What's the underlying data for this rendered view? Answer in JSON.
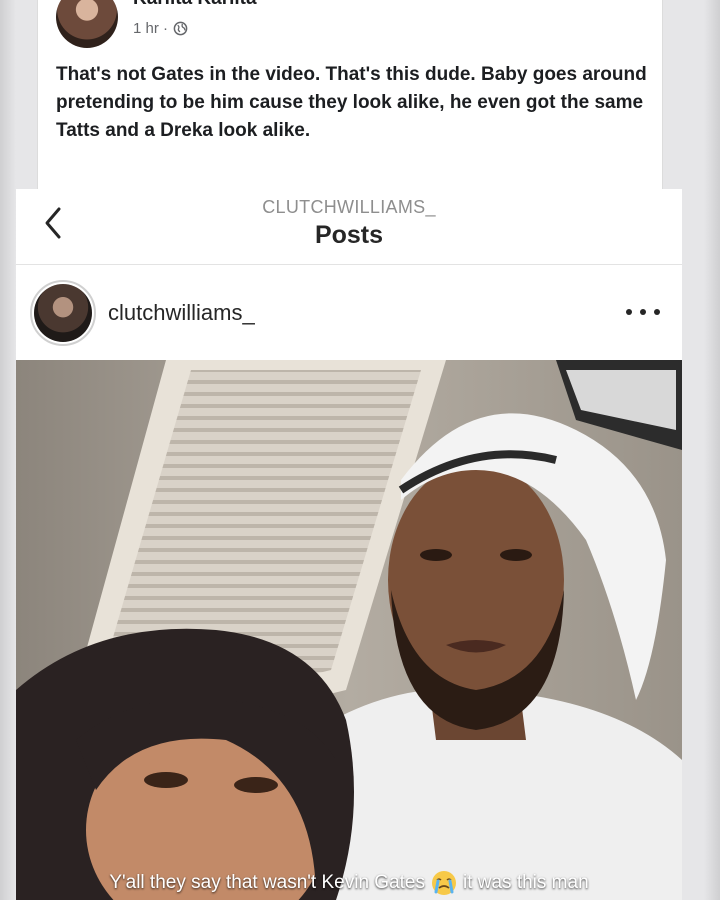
{
  "facebook_comment": {
    "author": "Karlita Karlita",
    "time": "1 hr ·",
    "text": "That's not Gates in the video. That's this dude. Baby goes around pretending to be him cause they look alike, he even got the same Tatts and a Dreka look alike."
  },
  "instagram": {
    "header_username": "CLUTCHWILLIAMS_",
    "header_title": "Posts",
    "post_username": "clutchwilliams_",
    "caption_before": "Y'all they say that wasn't Kevin Gates",
    "caption_emoji": "crying-face-emoji",
    "caption_after": "it was this man"
  },
  "icons": {
    "back": "chevron-left-icon",
    "more": "more-dots-icon",
    "privacy": "globe-icon"
  },
  "colors": {
    "text_primary": "#1c1e21",
    "text_secondary": "#65676b",
    "ig_gray": "#8e8e8e",
    "background": "#e6e6e8"
  }
}
